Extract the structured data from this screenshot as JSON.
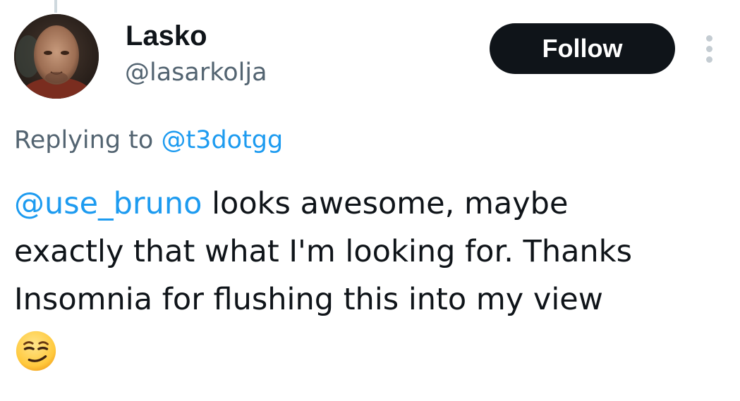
{
  "author": {
    "name": "Lasko",
    "handle": "@lasarkolja",
    "avatar": "profile-photo"
  },
  "actions": {
    "follow_label": "Follow",
    "more_icon": "vertical-ellipsis-icon"
  },
  "reply": {
    "prefix": "Replying to ",
    "to_handle": "@t3dotgg"
  },
  "tweet": {
    "mention": "@use_bruno",
    "line1_rest": " looks awesome, maybe",
    "line2": "exactly that what I'm looking for. Thanks",
    "line3": "Insomnia for flushing  this into my view",
    "emoji": "smirking-face-emoji"
  },
  "colors": {
    "link": "#1d9bf0",
    "text": "#0f1419",
    "muted": "#536471",
    "button_bg": "#0f1419",
    "button_text": "#ffffff"
  }
}
